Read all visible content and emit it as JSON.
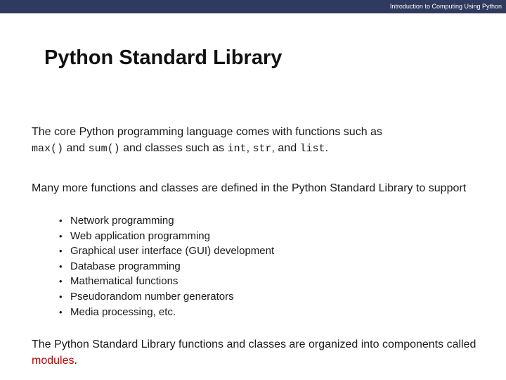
{
  "header": {
    "course_title": "Introduction to Computing Using Python"
  },
  "slide": {
    "title": "Python Standard Library",
    "p1": {
      "t1": "The core Python programming language comes with functions such as",
      "c1": "max()",
      "t2": " and ",
      "c2": "sum()",
      "t3": " and classes such as ",
      "c3": "int",
      "t4": ", ",
      "c4": "str",
      "t5": ", and ",
      "c5": "list",
      "t6": "."
    },
    "p2": "Many more functions and classes are defined in the Python Standard Library to support",
    "bullets": [
      "Network programming",
      "Web application programming",
      "Graphical user interface (GUI) development",
      "Database programming",
      "Mathematical functions",
      "Pseudorandom number generators",
      "Media processing, etc."
    ],
    "p3": {
      "t1": "The Python Standard Library functions and classes are organized into components called ",
      "highlight": "modules",
      "t2": "."
    },
    "colors": {
      "header_bg": "#2f3a5e",
      "accent": "#c00000"
    }
  }
}
